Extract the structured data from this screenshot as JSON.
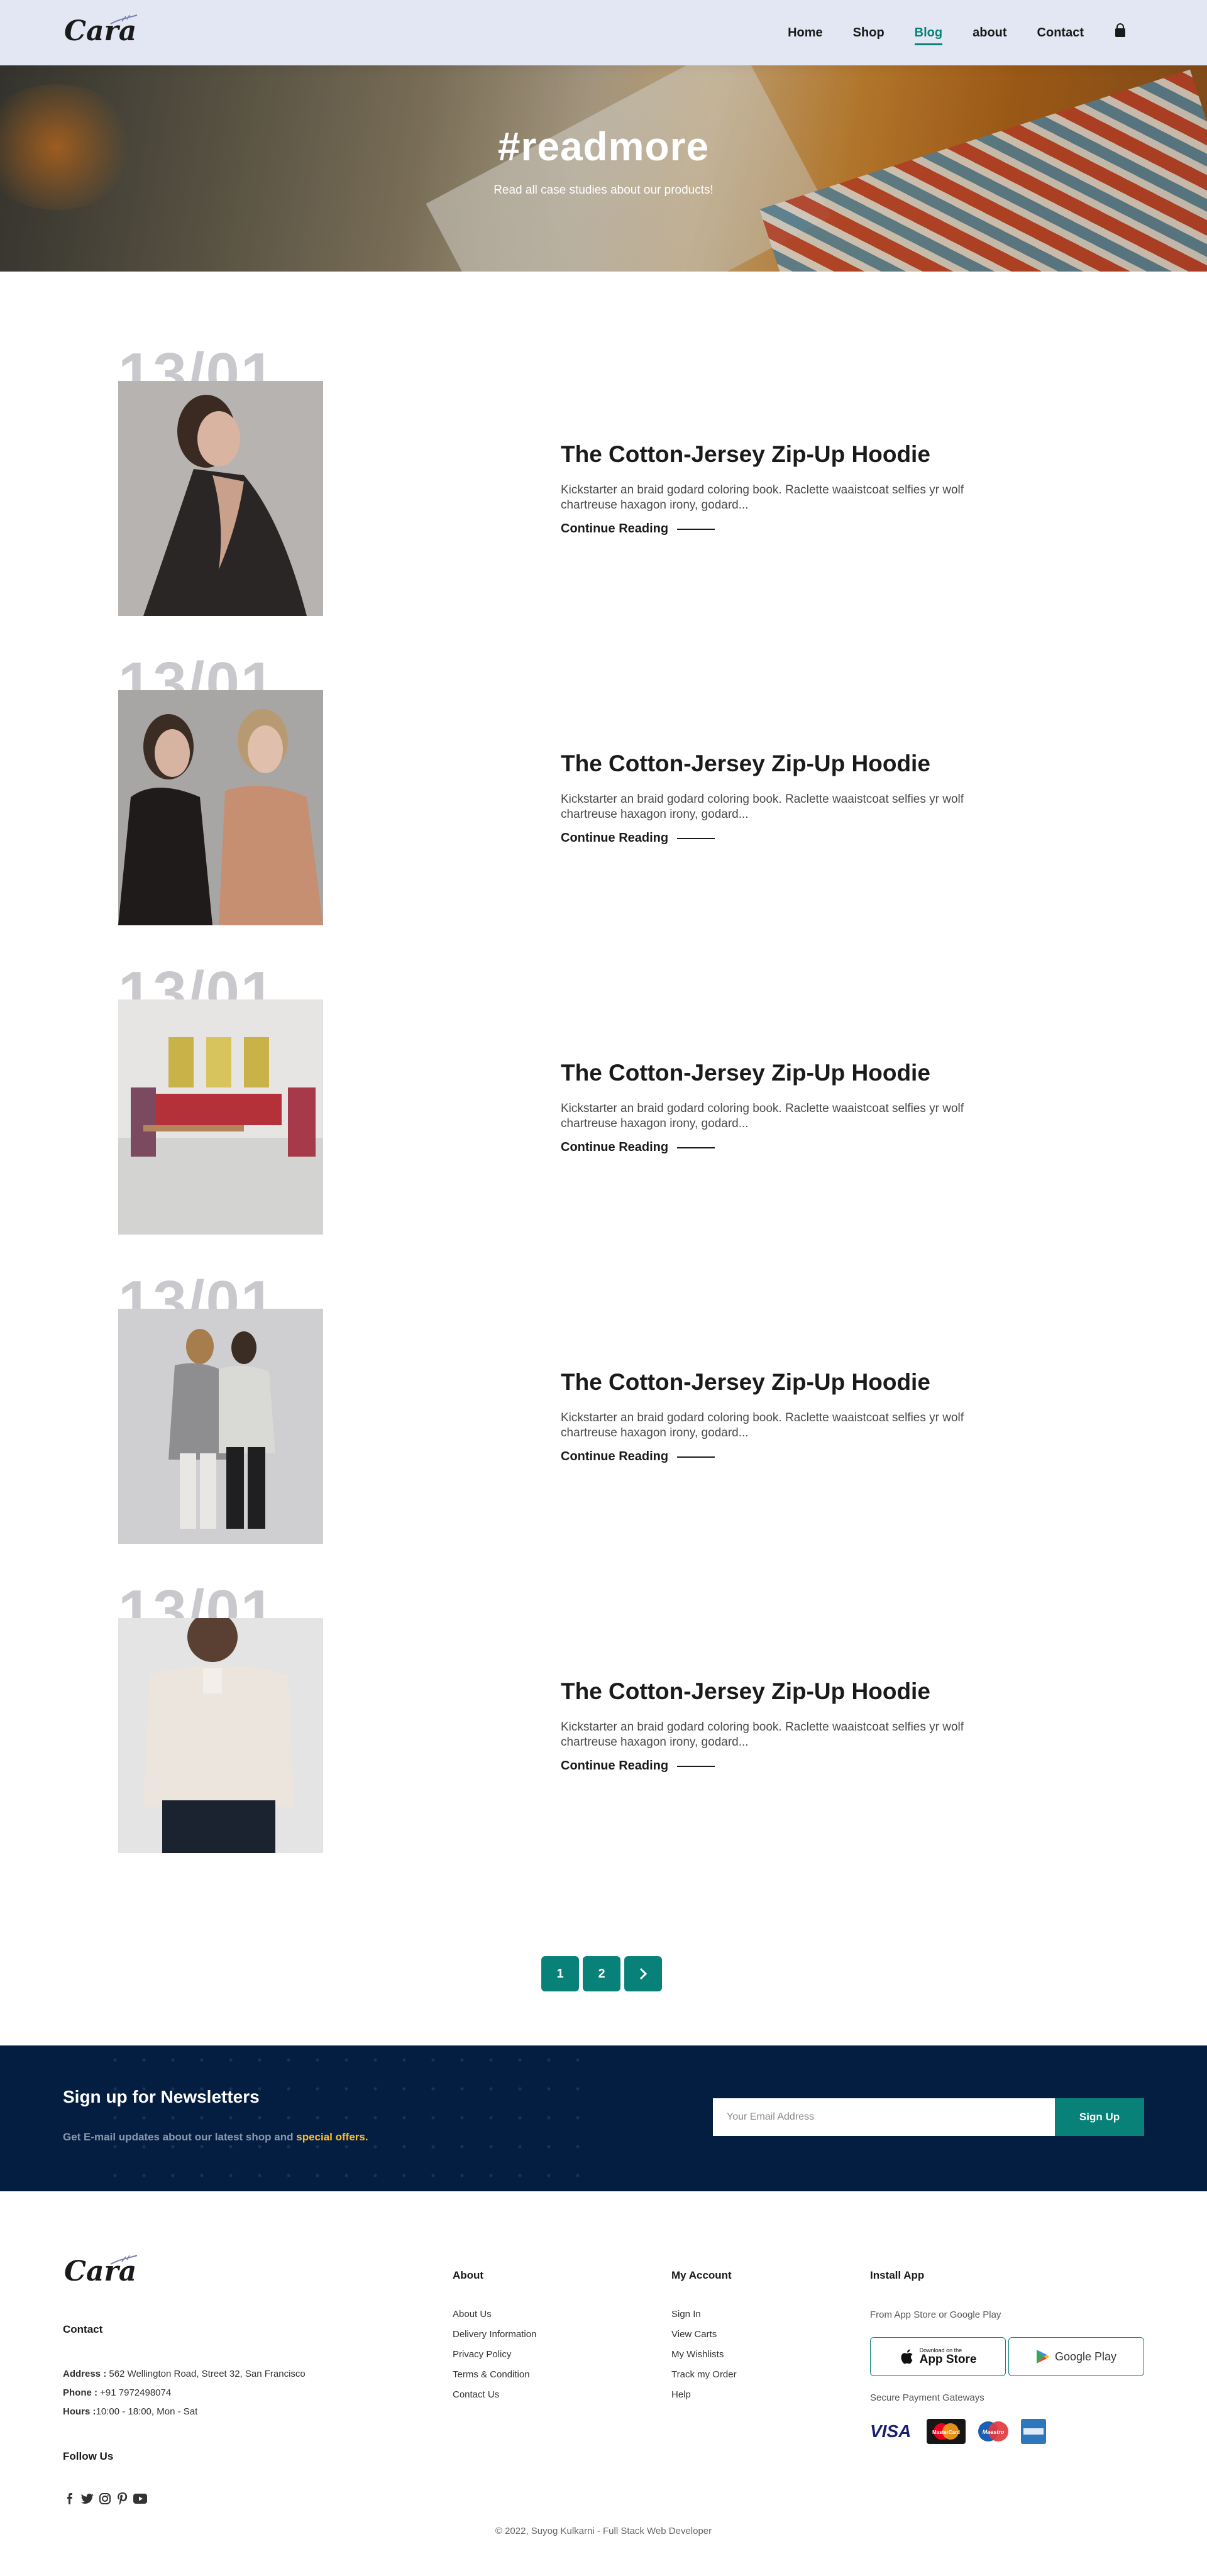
{
  "brand": {
    "logo_text": "Cara"
  },
  "nav": {
    "items": [
      {
        "label": "Home"
      },
      {
        "label": "Shop"
      },
      {
        "label": "Blog"
      },
      {
        "label": "about"
      },
      {
        "label": "Contact"
      }
    ],
    "active": "Blog",
    "cart_icon": "bag-icon"
  },
  "hero": {
    "title": "#readmore",
    "subtitle": "Read all case studies about our products!"
  },
  "posts": [
    {
      "date": "13/01",
      "title": "The Cotton-Jersey Zip-Up Hoodie",
      "excerpt": "Kickstarter an braid godard coloring book. Raclette waaistcoat selfies yr wolf chartreuse haxagon irony, godard...",
      "link": "Continue Reading"
    },
    {
      "date": "13/01",
      "title": "The Cotton-Jersey Zip-Up Hoodie",
      "excerpt": "Kickstarter an braid godard coloring book. Raclette waaistcoat selfies yr wolf chartreuse haxagon irony, godard...",
      "link": "Continue Reading"
    },
    {
      "date": "13/01",
      "title": "The Cotton-Jersey Zip-Up Hoodie",
      "excerpt": "Kickstarter an braid godard coloring book. Raclette waaistcoat selfies yr wolf chartreuse haxagon irony, godard...",
      "link": "Continue Reading"
    },
    {
      "date": "13/01",
      "title": "The Cotton-Jersey Zip-Up Hoodie",
      "excerpt": "Kickstarter an braid godard coloring book. Raclette waaistcoat selfies yr wolf chartreuse haxagon irony, godard...",
      "link": "Continue Reading"
    },
    {
      "date": "13/01",
      "title": "The Cotton-Jersey Zip-Up Hoodie",
      "excerpt": "Kickstarter an braid godard coloring book. Raclette waaistcoat selfies yr wolf chartreuse haxagon irony, godard...",
      "link": "Continue Reading"
    }
  ],
  "pagination": {
    "pages": [
      "1",
      "2"
    ],
    "next_icon": "chevron-right-icon"
  },
  "newsletter": {
    "title": "Sign up for Newsletters",
    "text": "Get E-mail updates about our latest shop and",
    "highlight": "special offers.",
    "placeholder": "Your Email Address",
    "button": "Sign Up"
  },
  "footer": {
    "contact": {
      "heading": "Contact",
      "address_label": "Address :",
      "address": "562 Wellington Road, Street 32, San Francisco",
      "phone_label": "Phone :",
      "phone": "+91 7972498074",
      "hours_label": "Hours :",
      "hours": "10:00 - 18:00, Mon - Sat",
      "follow": "Follow Us"
    },
    "about": {
      "heading": "About",
      "links": [
        "About Us",
        "Delivery Information",
        "Privacy Policy",
        "Terms & Condition",
        "Contact Us"
      ]
    },
    "account": {
      "heading": "My Account",
      "links": [
        "Sign In",
        "View Carts",
        "My Wishlists",
        "Track my Order",
        "Help"
      ]
    },
    "install": {
      "heading": "Install App",
      "from": "From App Store or Google Play",
      "app_store_small": "Download on the",
      "app_store": "App Store",
      "google_play": "Google Play",
      "gateways": "Secure Payment Gateways"
    },
    "payment": {
      "visa": "VISA",
      "mastercard": "MasterCard",
      "maestro": "Maestro"
    },
    "copyright": "© 2022, Suyog Kulkarni - Full Stack Web Developer"
  },
  "colors": {
    "accent": "#088178",
    "header_bg": "#e3e6f3",
    "newsletter_bg": "#041e42",
    "highlight": "#ffbd27"
  }
}
